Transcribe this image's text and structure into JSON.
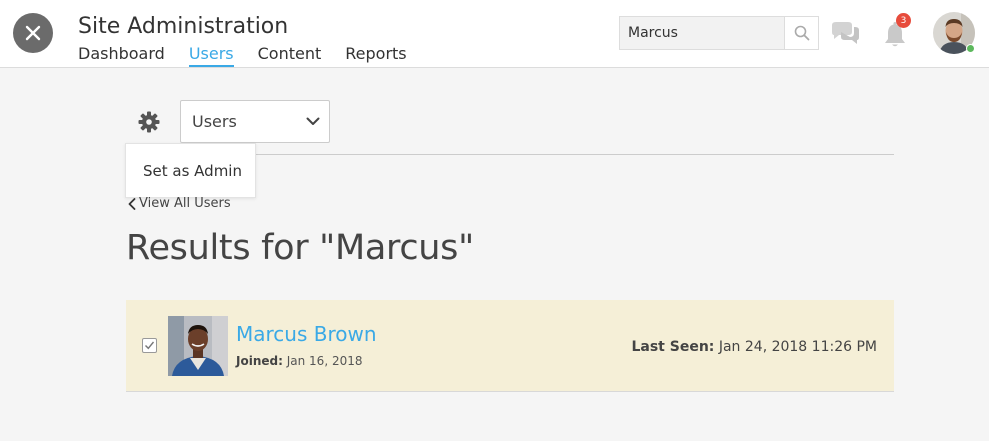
{
  "header": {
    "title": "Site Administration",
    "nav": [
      "Dashboard",
      "Users",
      "Content",
      "Reports"
    ],
    "active_nav": "Users",
    "search_value": "Marcus",
    "notification_count": "3",
    "accent_color": "#3aa9e6",
    "badge_color": "#e74c3c",
    "icons": [
      "close-icon",
      "search-icon",
      "chat-icon",
      "bell-icon",
      "avatar"
    ]
  },
  "toolbar": {
    "select_value": "Users",
    "dropdown_item": "Set as Admin",
    "icons": [
      "gear-icon",
      "chevron-down-icon"
    ]
  },
  "back_link": "View All Users",
  "results_title": "Results for \"Marcus\"",
  "result": {
    "checked": true,
    "name": "Marcus Brown",
    "joined_label": "Joined:",
    "joined_date": "Jan 16, 2018",
    "last_seen_label": "Last Seen:",
    "last_seen_value": "Jan 24, 2018 11:26 PM",
    "row_color": "#f5efd7"
  }
}
